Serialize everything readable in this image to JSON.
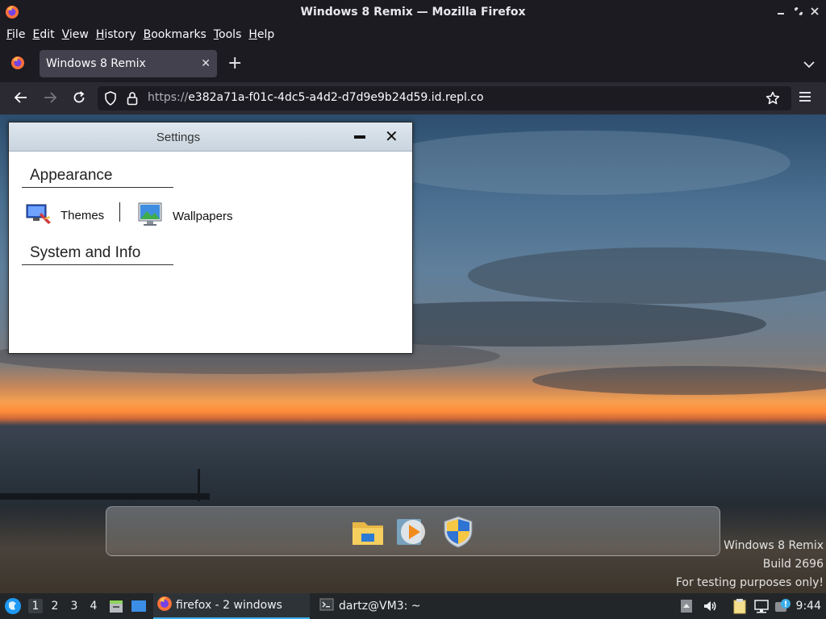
{
  "window": {
    "title": "Windows 8 Remix — Mozilla Firefox",
    "minimize_glyph": "▬",
    "maximize_glyph": "⬍",
    "close_glyph": "✕"
  },
  "menubar": {
    "items": [
      {
        "label_ul": "F",
        "label_rest": "ile"
      },
      {
        "label_ul": "E",
        "label_rest": "dit"
      },
      {
        "label_ul": "V",
        "label_rest": "iew"
      },
      {
        "label_ul": "H",
        "label_rest": "istory"
      },
      {
        "label_ul": "B",
        "label_rest": "ookmarks"
      },
      {
        "label_ul": "T",
        "label_rest": "ools"
      },
      {
        "label_ul": "H",
        "label_rest": "elp"
      }
    ]
  },
  "tabs": {
    "active": {
      "label": "Windows 8 Remix",
      "close": "✕"
    },
    "new_tab": "+"
  },
  "navbar": {
    "url_scheme": "https://",
    "url_host": "e382a71a-f01c-4dc5-a4d2-d7d9e9b24d59.id.repl.co"
  },
  "settings": {
    "title": "Settings",
    "sections": {
      "appearance": "Appearance",
      "system": "System and Info"
    },
    "items": {
      "themes": "Themes",
      "wallpapers": "Wallpapers"
    }
  },
  "watermark": {
    "line1": "Windows 8 Remix",
    "line2": "Build 2696",
    "line3": "For testing purposes only!"
  },
  "taskbar": {
    "workspaces": [
      "1",
      "2",
      "3",
      "4"
    ],
    "tasks": {
      "firefox": "firefox - 2 windows",
      "terminal": "dartz@VM3: ~"
    },
    "clock": "9:44"
  },
  "colors": {
    "accent": "#3daee9",
    "chrome_dark": "#1c1b22",
    "tab_active": "#42414d"
  }
}
